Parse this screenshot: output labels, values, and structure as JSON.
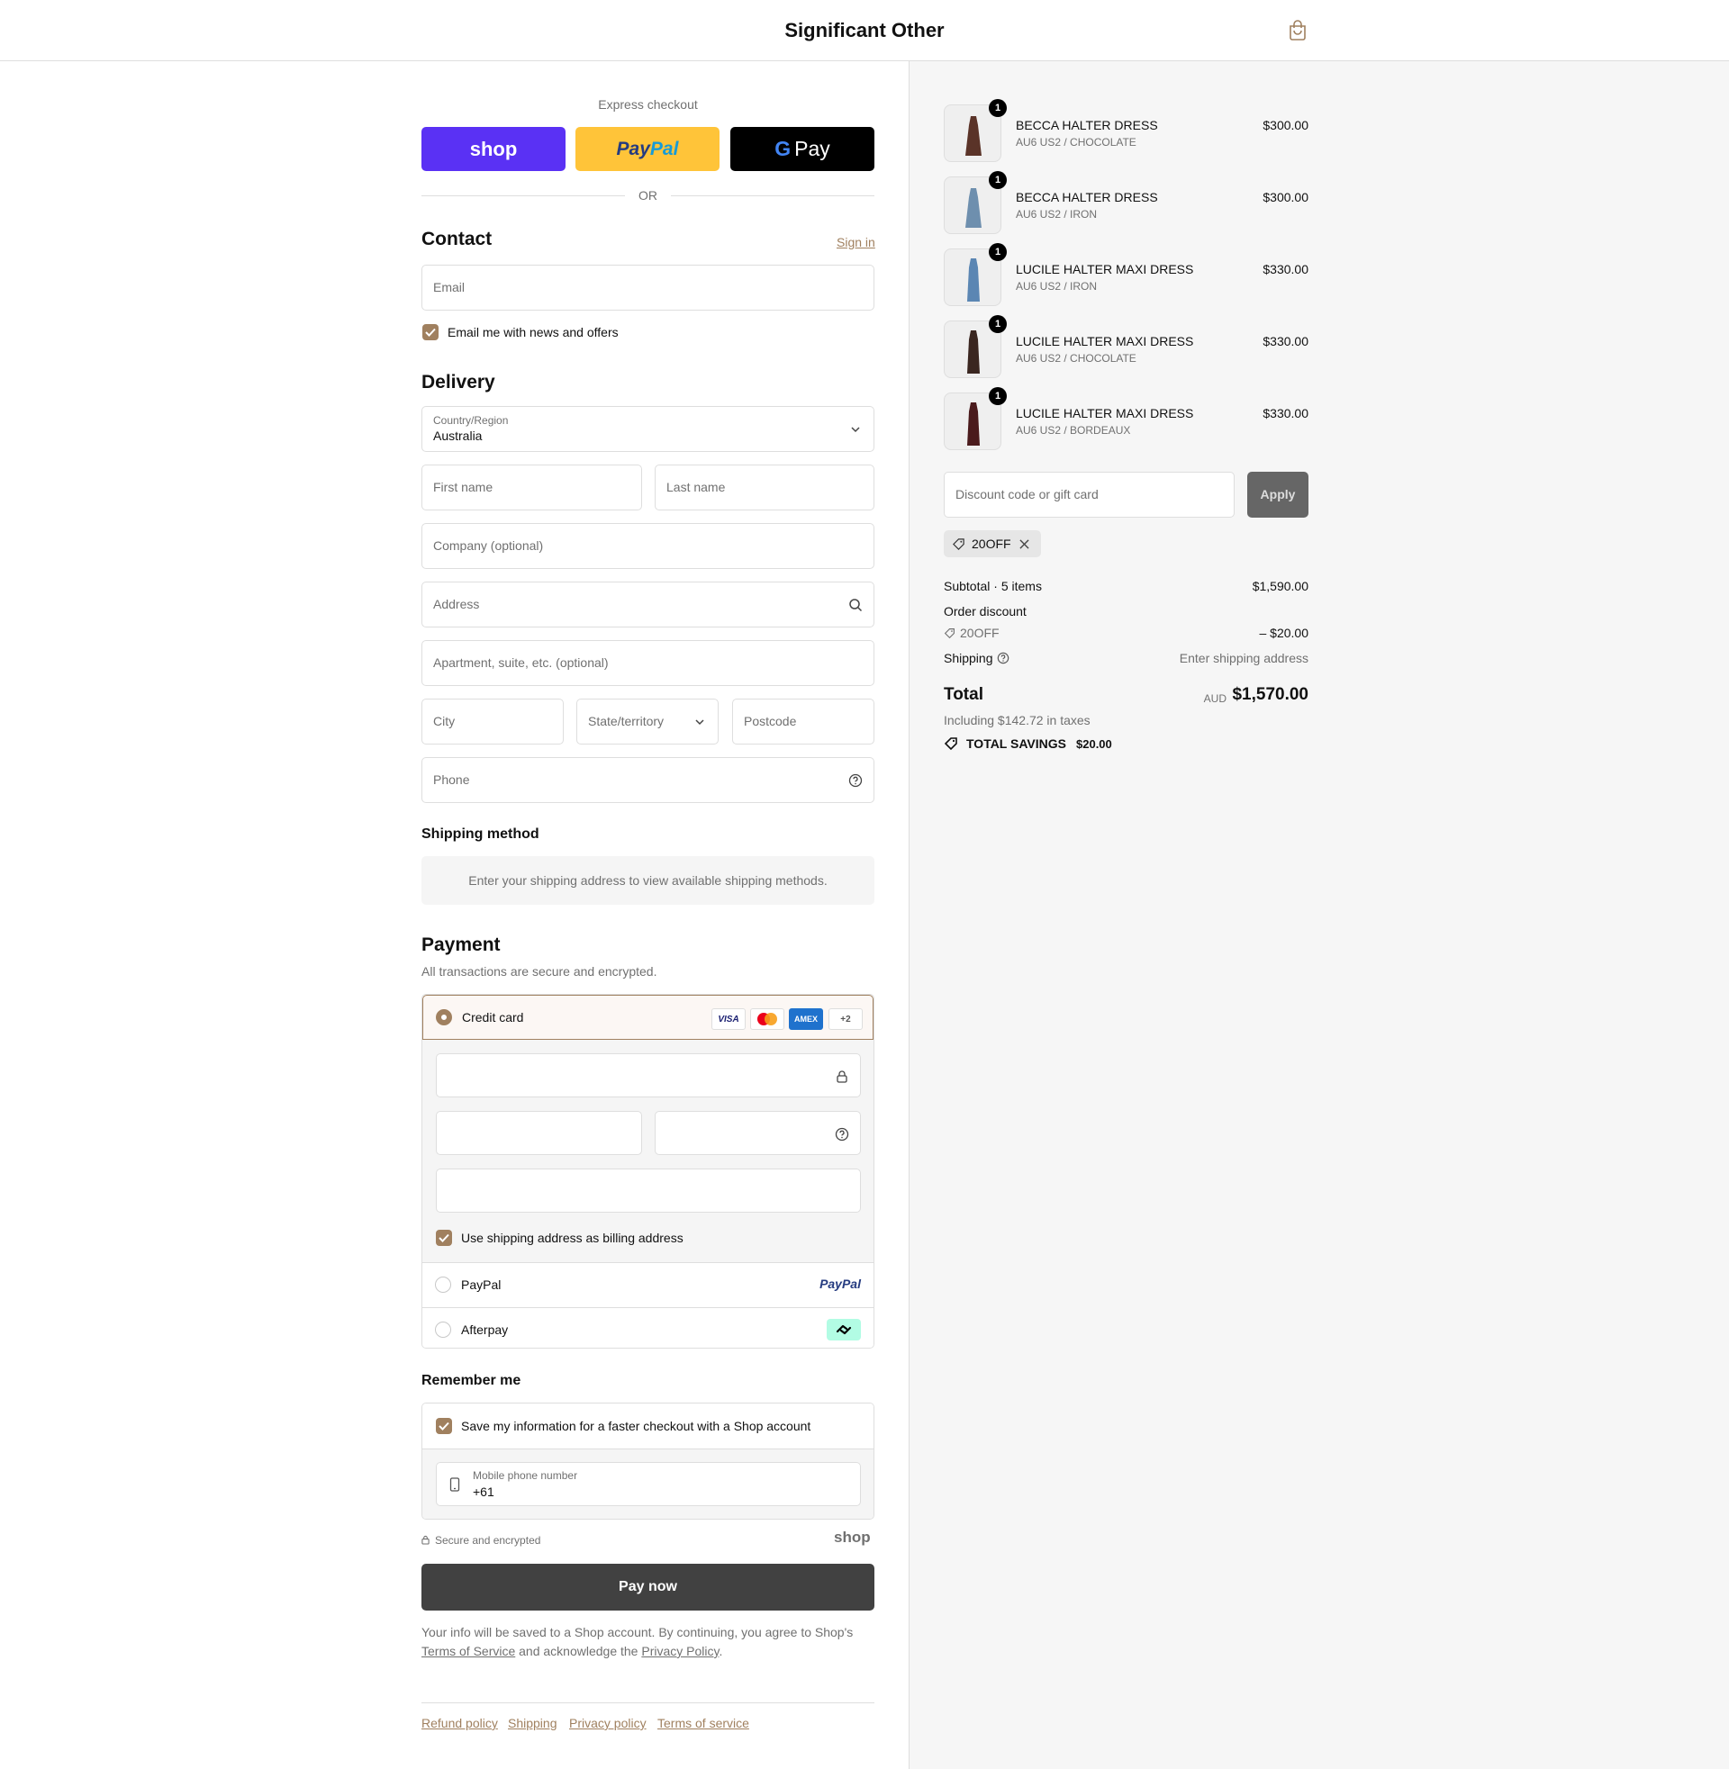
{
  "header": {
    "store_name": "Significant Other"
  },
  "express": {
    "label": "Express checkout",
    "shop_label": "shop",
    "paypal_label_a": "Pay",
    "paypal_label_b": "Pal",
    "gpay_label": "Pay",
    "or_label": "OR"
  },
  "contact": {
    "title": "Contact",
    "sign_in": "Sign in",
    "email_placeholder": "Email",
    "newsletter_label": "Email me with news and offers"
  },
  "delivery": {
    "title": "Delivery",
    "country_label": "Country/Region",
    "country_value": "Australia",
    "first_name": "First name",
    "last_name": "Last name",
    "company": "Company (optional)",
    "address": "Address",
    "apartment": "Apartment, suite, etc. (optional)",
    "city": "City",
    "state": "State/territory",
    "postcode": "Postcode",
    "phone": "Phone"
  },
  "shipping_method": {
    "title": "Shipping method",
    "notice": "Enter your shipping address to view available shipping methods."
  },
  "payment": {
    "title": "Payment",
    "subtitle": "All transactions are secure and encrypted.",
    "credit_card_label": "Credit card",
    "card_logos": [
      "VISA",
      "mastercard",
      "AMEX"
    ],
    "more_cards": "+2",
    "billing_same_label": "Use shipping address as billing address",
    "paypal_label": "PayPal",
    "paypal_logo": "PayPal",
    "afterpay_label": "Afterpay"
  },
  "remember": {
    "title": "Remember me",
    "save_label": "Save my information for a faster checkout with a Shop account",
    "phone_label": "Mobile phone number",
    "phone_value": "+61",
    "secure_label": "Secure and encrypted",
    "shop_mark": "shop"
  },
  "pay_now": "Pay now",
  "legal": {
    "text_a": "Your info will be saved to a Shop account. By continuing, you agree to Shop's",
    "terms": "Terms of Service",
    "text_b": "and acknowledge the",
    "privacy": "Privacy Policy",
    "text_c": "."
  },
  "footer_links": [
    "Refund policy",
    "Shipping",
    "Privacy policy",
    "Terms of service"
  ],
  "cart": {
    "items": [
      {
        "qty": "1",
        "name": "BECCA HALTER DRESS",
        "variant": "AU6 US2 / CHOCOLATE",
        "price": "$300.00",
        "color": "#5a3328"
      },
      {
        "qty": "1",
        "name": "BECCA HALTER DRESS",
        "variant": "AU6 US2 / IRON",
        "price": "$300.00",
        "color": "#6e8fae"
      },
      {
        "qty": "1",
        "name": "LUCILE HALTER MAXI DRESS",
        "variant": "AU6 US2 / IRON",
        "price": "$330.00",
        "color": "#5b86b3"
      },
      {
        "qty": "1",
        "name": "LUCILE HALTER MAXI DRESS",
        "variant": "AU6 US2 / CHOCOLATE",
        "price": "$330.00",
        "color": "#3a2620"
      },
      {
        "qty": "1",
        "name": "LUCILE HALTER MAXI DRESS",
        "variant": "AU6 US2 / BORDEAUX",
        "price": "$330.00",
        "color": "#4a1a1c"
      }
    ],
    "discount_placeholder": "Discount code or gift card",
    "apply": "Apply",
    "applied_code": "20OFF",
    "subtotal_label": "Subtotal · 5 items",
    "subtotal_value": "$1,590.00",
    "order_discount_label": "Order discount",
    "discount_code": "20OFF",
    "discount_value": "– $20.00",
    "shipping_label": "Shipping",
    "shipping_value": "Enter shipping address",
    "total_label": "Total",
    "currency": "AUD",
    "total_value": "$1,570.00",
    "taxes": "Including $142.72 in taxes",
    "savings_label": "TOTAL SAVINGS",
    "savings_value": "$20.00"
  },
  "colors": {
    "accent": "#a0805f",
    "shop_purple": "#5a31f4",
    "paypal_yellow": "#ffc439",
    "pay_button": "#414141"
  }
}
